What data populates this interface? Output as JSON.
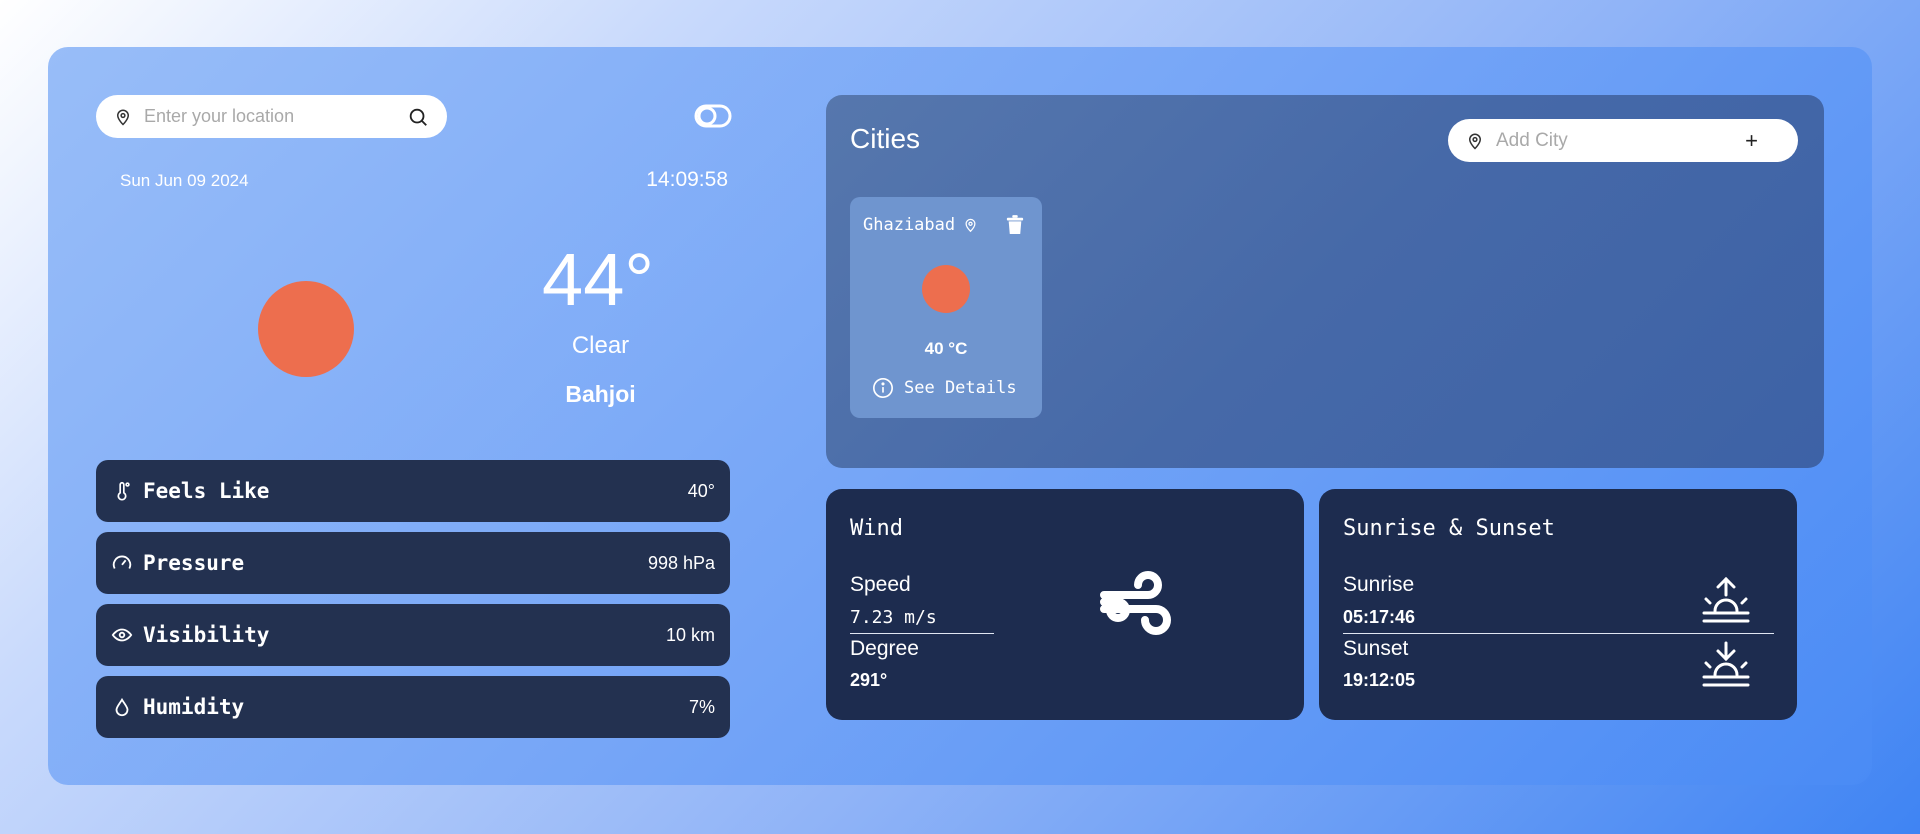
{
  "search": {
    "placeholder": "Enter your location"
  },
  "header": {
    "date": "Sun Jun 09 2024",
    "time": "14:09:58"
  },
  "current": {
    "temperature": "44°",
    "condition": "Clear",
    "city": "Bahjoi"
  },
  "stats": [
    {
      "label": "Feels Like",
      "value": "40°",
      "icon": "thermometer-icon"
    },
    {
      "label": "Pressure",
      "value": "998 hPa",
      "icon": "gauge-icon"
    },
    {
      "label": "Visibility",
      "value": "10 km",
      "icon": "eye-icon"
    },
    {
      "label": "Humidity",
      "value": "7%",
      "icon": "droplet-icon"
    }
  ],
  "cities": {
    "title": "Cities",
    "add_placeholder": "Add City",
    "add_symbol": "+",
    "items": [
      {
        "name": "Ghaziabad",
        "temp": "40 °C",
        "details_label": "See Details"
      }
    ]
  },
  "wind": {
    "title": "Wind",
    "speed_label": "Speed",
    "speed_value": "7.23 m/s",
    "degree_label": "Degree",
    "degree_value": "291°"
  },
  "sun": {
    "title": "Sunrise & Sunset",
    "sunrise_label": "Sunrise",
    "sunrise_value": "05:17:46",
    "sunset_label": "Sunset",
    "sunset_value": "19:12:05"
  },
  "colors": {
    "sun": "#ed6e4e",
    "card_dark": "#233150",
    "panel_dark": "#1d2c4f",
    "cities_panel": "#4a6cab"
  }
}
